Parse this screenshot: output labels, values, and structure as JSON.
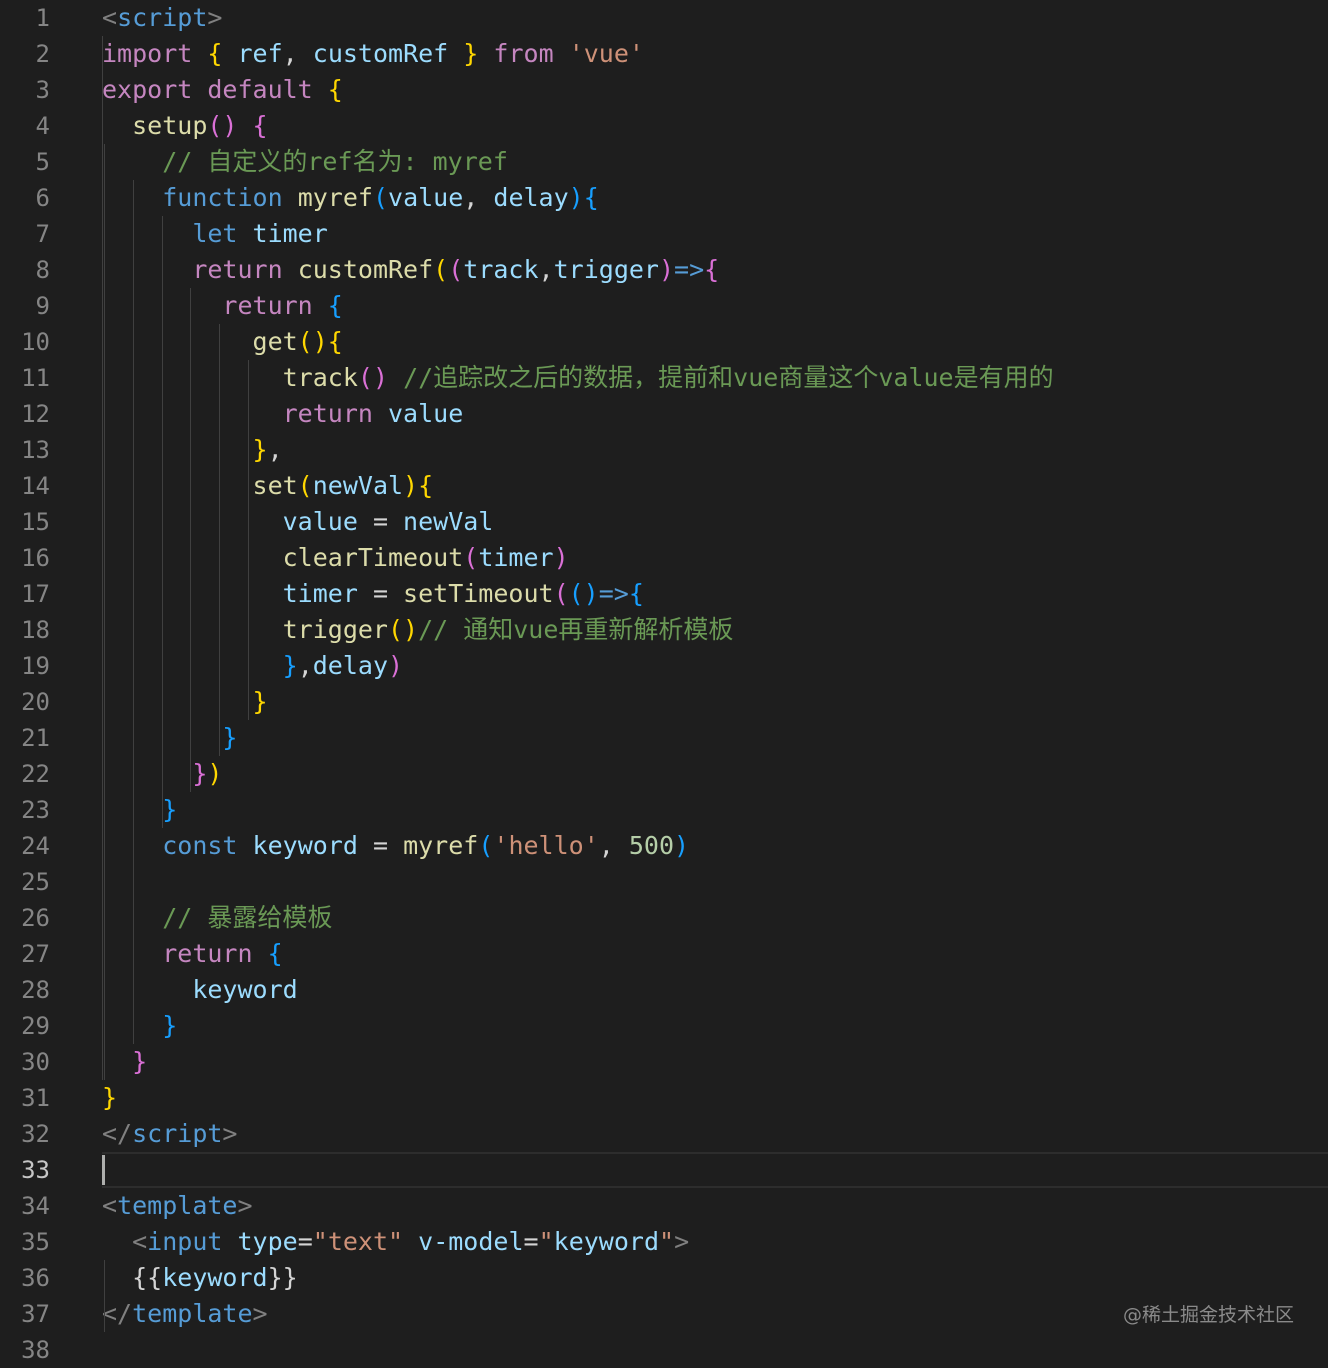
{
  "editor": {
    "active_line": 33,
    "watermark": "@稀土掘金技术社区",
    "lines": [
      [
        [
          "ang",
          "<"
        ],
        [
          "tg",
          "script"
        ],
        [
          "ang",
          ">"
        ]
      ],
      [
        [
          "kw",
          "import"
        ],
        [
          "op",
          " "
        ],
        [
          "b1",
          "{"
        ],
        [
          "op",
          " "
        ],
        [
          "vr",
          "ref"
        ],
        [
          "op",
          ", "
        ],
        [
          "vr",
          "customRef"
        ],
        [
          "op",
          " "
        ],
        [
          "b1",
          "}"
        ],
        [
          "op",
          " "
        ],
        [
          "kw",
          "from"
        ],
        [
          "op",
          " "
        ],
        [
          "str",
          "'vue'"
        ]
      ],
      [
        [
          "kw",
          "export"
        ],
        [
          "op",
          " "
        ],
        [
          "kw",
          "default"
        ],
        [
          "op",
          " "
        ],
        [
          "b1",
          "{"
        ]
      ],
      [
        [
          "op",
          "  "
        ],
        [
          "fn",
          "setup"
        ],
        [
          "b2",
          "()"
        ],
        [
          "op",
          " "
        ],
        [
          "b2",
          "{"
        ]
      ],
      [
        [
          "op",
          "    "
        ],
        [
          "cm",
          "// 自定义的ref名为: myref"
        ]
      ],
      [
        [
          "op",
          "    "
        ],
        [
          "st",
          "function"
        ],
        [
          "op",
          " "
        ],
        [
          "fn",
          "myref"
        ],
        [
          "b3",
          "("
        ],
        [
          "vr",
          "value"
        ],
        [
          "op",
          ", "
        ],
        [
          "vr",
          "delay"
        ],
        [
          "b3",
          ")"
        ],
        [
          "b3",
          "{"
        ]
      ],
      [
        [
          "op",
          "      "
        ],
        [
          "st",
          "let"
        ],
        [
          "op",
          " "
        ],
        [
          "vr",
          "timer"
        ]
      ],
      [
        [
          "op",
          "      "
        ],
        [
          "kw",
          "return"
        ],
        [
          "op",
          " "
        ],
        [
          "fn",
          "customRef"
        ],
        [
          "b1",
          "("
        ],
        [
          "b2",
          "("
        ],
        [
          "vr",
          "track"
        ],
        [
          "op",
          ","
        ],
        [
          "vr",
          "trigger"
        ],
        [
          "b2",
          ")"
        ],
        [
          "st",
          "=>"
        ],
        [
          "b2",
          "{"
        ]
      ],
      [
        [
          "op",
          "        "
        ],
        [
          "kw",
          "return"
        ],
        [
          "op",
          " "
        ],
        [
          "b3",
          "{"
        ]
      ],
      [
        [
          "op",
          "          "
        ],
        [
          "fn",
          "get"
        ],
        [
          "b1",
          "()"
        ],
        [
          "b1",
          "{"
        ]
      ],
      [
        [
          "op",
          "            "
        ],
        [
          "fn",
          "track"
        ],
        [
          "b2",
          "()"
        ],
        [
          "op",
          " "
        ],
        [
          "cm",
          "//追踪改之后的数据，提前和vue商量这个value是有用的"
        ]
      ],
      [
        [
          "op",
          "            "
        ],
        [
          "kw",
          "return"
        ],
        [
          "op",
          " "
        ],
        [
          "vr",
          "value"
        ]
      ],
      [
        [
          "op",
          "          "
        ],
        [
          "b1",
          "}"
        ],
        [
          "op",
          ","
        ]
      ],
      [
        [
          "op",
          "          "
        ],
        [
          "fn",
          "set"
        ],
        [
          "b1",
          "("
        ],
        [
          "vr",
          "newVal"
        ],
        [
          "b1",
          ")"
        ],
        [
          "b1",
          "{"
        ]
      ],
      [
        [
          "op",
          "            "
        ],
        [
          "vr",
          "value"
        ],
        [
          "op",
          " = "
        ],
        [
          "vr",
          "newVal"
        ]
      ],
      [
        [
          "op",
          "            "
        ],
        [
          "fn",
          "clearTimeout"
        ],
        [
          "b2",
          "("
        ],
        [
          "vr",
          "timer"
        ],
        [
          "b2",
          ")"
        ]
      ],
      [
        [
          "op",
          "            "
        ],
        [
          "vr",
          "timer"
        ],
        [
          "op",
          " = "
        ],
        [
          "fn",
          "setTimeout"
        ],
        [
          "b2",
          "("
        ],
        [
          "b3",
          "()"
        ],
        [
          "st",
          "=>"
        ],
        [
          "b3",
          "{"
        ]
      ],
      [
        [
          "op",
          "            "
        ],
        [
          "fn",
          "trigger"
        ],
        [
          "b1",
          "()"
        ],
        [
          "cm",
          "// 通知vue再重新解析模板"
        ]
      ],
      [
        [
          "op",
          "            "
        ],
        [
          "b3",
          "}"
        ],
        [
          "op",
          ","
        ],
        [
          "vr",
          "delay"
        ],
        [
          "b2",
          ")"
        ]
      ],
      [
        [
          "op",
          "          "
        ],
        [
          "b1",
          "}"
        ]
      ],
      [
        [
          "op",
          "        "
        ],
        [
          "b3",
          "}"
        ]
      ],
      [
        [
          "op",
          "      "
        ],
        [
          "b2",
          "}"
        ],
        [
          "b1",
          ")"
        ]
      ],
      [
        [
          "op",
          "    "
        ],
        [
          "b3",
          "}"
        ]
      ],
      [
        [
          "op",
          "    "
        ],
        [
          "st",
          "const"
        ],
        [
          "op",
          " "
        ],
        [
          "vr",
          "keyword"
        ],
        [
          "op",
          " = "
        ],
        [
          "fn",
          "myref"
        ],
        [
          "b3",
          "("
        ],
        [
          "str",
          "'hello'"
        ],
        [
          "op",
          ", "
        ],
        [
          "nm",
          "500"
        ],
        [
          "b3",
          ")"
        ]
      ],
      [],
      [
        [
          "op",
          "    "
        ],
        [
          "cm",
          "// 暴露给模板"
        ]
      ],
      [
        [
          "op",
          "    "
        ],
        [
          "kw",
          "return"
        ],
        [
          "op",
          " "
        ],
        [
          "b3",
          "{"
        ]
      ],
      [
        [
          "op",
          "      "
        ],
        [
          "vr",
          "keyword"
        ]
      ],
      [
        [
          "op",
          "    "
        ],
        [
          "b3",
          "}"
        ]
      ],
      [
        [
          "op",
          "  "
        ],
        [
          "b2",
          "}"
        ]
      ],
      [
        [
          "b1",
          "}"
        ]
      ],
      [
        [
          "ang",
          "</"
        ],
        [
          "tg",
          "script"
        ],
        [
          "ang",
          ">"
        ]
      ],
      [],
      [
        [
          "ang",
          "<"
        ],
        [
          "tg",
          "template"
        ],
        [
          "ang",
          ">"
        ]
      ],
      [
        [
          "op",
          "  "
        ],
        [
          "ang",
          "<"
        ],
        [
          "tg",
          "input"
        ],
        [
          "op",
          " "
        ],
        [
          "at",
          "type"
        ],
        [
          "op",
          "="
        ],
        [
          "str",
          "\"text\""
        ],
        [
          "op",
          " "
        ],
        [
          "at",
          "v-model"
        ],
        [
          "op",
          "="
        ],
        [
          "str",
          "\""
        ],
        [
          "vr",
          "keyword"
        ],
        [
          "str",
          "\""
        ],
        [
          "ang",
          ">"
        ]
      ],
      [
        [
          "op",
          "  {{"
        ],
        [
          "vr",
          "keyword"
        ],
        [
          "op",
          "}}"
        ]
      ],
      [
        [
          "ang",
          "</"
        ],
        [
          "tg",
          "template"
        ],
        [
          "ang",
          ">"
        ]
      ],
      []
    ]
  }
}
